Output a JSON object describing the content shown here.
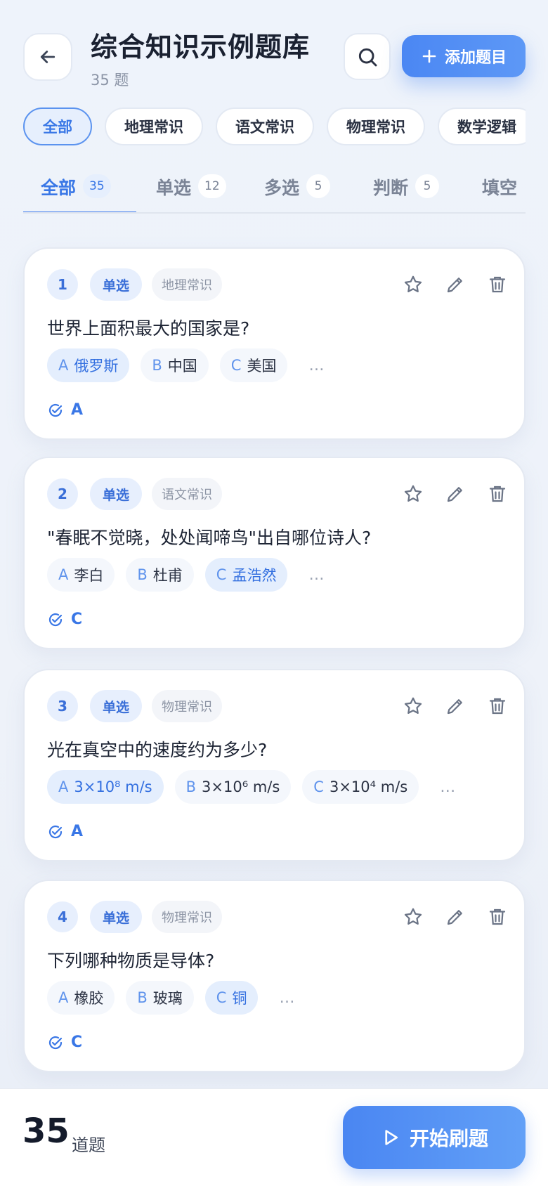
{
  "header": {
    "title": "综合知识示例题库",
    "subtitle": "35 题",
    "add_label": "添加题目"
  },
  "categories": [
    {
      "label": "全部",
      "active": true
    },
    {
      "label": "地理常识",
      "active": false
    },
    {
      "label": "语文常识",
      "active": false
    },
    {
      "label": "物理常识",
      "active": false
    },
    {
      "label": "数学逻辑",
      "active": false
    }
  ],
  "tabs": [
    {
      "label": "全部",
      "count": "35",
      "active": true
    },
    {
      "label": "单选",
      "count": "12",
      "active": false
    },
    {
      "label": "多选",
      "count": "5",
      "active": false
    },
    {
      "label": "判断",
      "count": "5",
      "active": false
    },
    {
      "label": "填空",
      "count": "",
      "active": false
    }
  ],
  "questions": [
    {
      "num": "1",
      "type": "单选",
      "category": "地理常识",
      "text": "世界上面积最大的国家是?",
      "options": [
        {
          "letter": "A",
          "text": "俄罗斯",
          "correct": true
        },
        {
          "letter": "B",
          "text": "中国",
          "correct": false
        },
        {
          "letter": "C",
          "text": "美国",
          "correct": false
        }
      ],
      "more": "…",
      "answer": "A"
    },
    {
      "num": "2",
      "type": "单选",
      "category": "语文常识",
      "text": "\"春眠不觉晓，处处闻啼鸟\"出自哪位诗人?",
      "options": [
        {
          "letter": "A",
          "text": "李白",
          "correct": false
        },
        {
          "letter": "B",
          "text": "杜甫",
          "correct": false
        },
        {
          "letter": "C",
          "text": "孟浩然",
          "correct": true
        }
      ],
      "more": "…",
      "answer": "C"
    },
    {
      "num": "3",
      "type": "单选",
      "category": "物理常识",
      "text": "光在真空中的速度约为多少?",
      "options": [
        {
          "letter": "A",
          "text": "3×10⁸ m/s",
          "correct": true
        },
        {
          "letter": "B",
          "text": "3×10⁶ m/s",
          "correct": false
        },
        {
          "letter": "C",
          "text": "3×10⁴ m/s",
          "correct": false
        }
      ],
      "more": "…",
      "answer": "A"
    },
    {
      "num": "4",
      "type": "单选",
      "category": "物理常识",
      "text": "下列哪种物质是导体?",
      "options": [
        {
          "letter": "A",
          "text": "橡胶",
          "correct": false
        },
        {
          "letter": "B",
          "text": "玻璃",
          "correct": false
        },
        {
          "letter": "C",
          "text": "铜",
          "correct": true
        }
      ],
      "more": "…",
      "answer": "C"
    }
  ],
  "footer": {
    "total": "35",
    "unit": "道题",
    "start_label": "开始刷题"
  },
  "icons": {
    "back": "arrow-left-icon",
    "search": "search-icon",
    "add": "plus-icon",
    "favorite": "star-icon",
    "edit": "pencil-icon",
    "delete": "trash-icon",
    "answer": "check-circle-icon",
    "start": "play-icon"
  },
  "colors": {
    "accent": "#4a86f2",
    "accent_light": "#e6effd",
    "background": "#eef3fb"
  }
}
